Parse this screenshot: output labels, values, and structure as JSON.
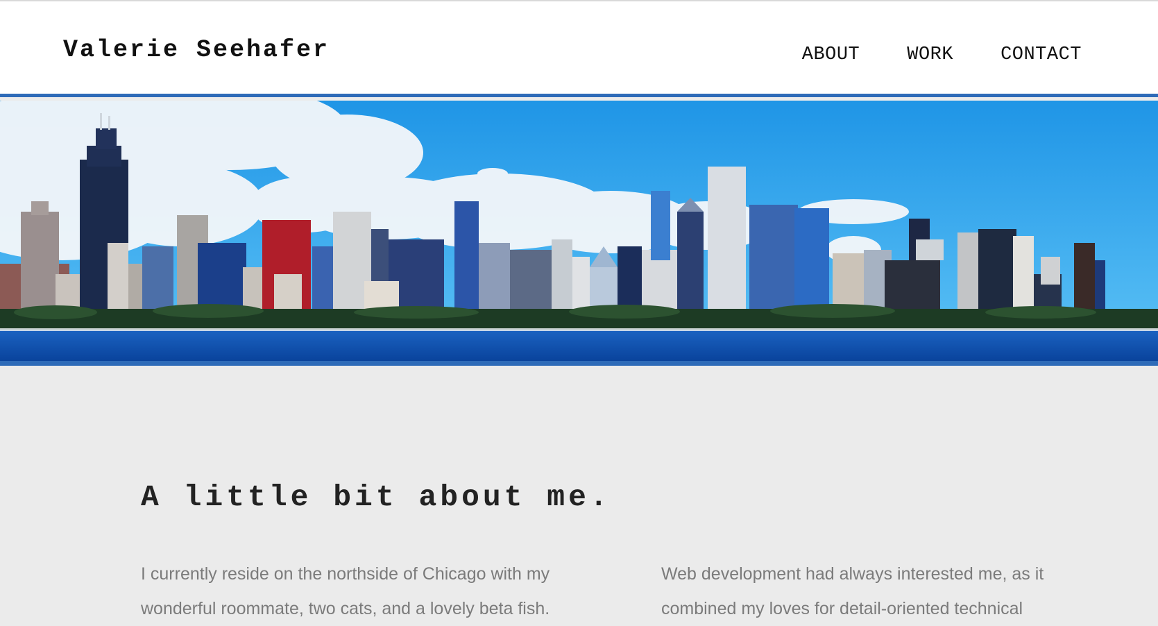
{
  "header": {
    "site_name": "Valerie Seehafer",
    "nav": [
      {
        "label": "ABOUT"
      },
      {
        "label": "WORK"
      },
      {
        "label": "CONTACT"
      }
    ]
  },
  "colors": {
    "accent_rule": "#2e6bb8",
    "header_bg": "#ffffff",
    "page_bg": "#ebebeb",
    "body_text": "#7b7b7b",
    "heading_text": "#222222",
    "sky": "#2aa3ec",
    "lake": "#0a4aa8"
  },
  "hero": {
    "image_subject": "Chicago skyline across the lake"
  },
  "about": {
    "title": "A little bit about me.",
    "paragraph_left": "I currently reside on the northside of Chicago with my wonderful roommate, two cats, and a lovely beta fish.",
    "paragraph_right": "Web development had always interested me, as it combined my loves for detail-oriented technical"
  }
}
